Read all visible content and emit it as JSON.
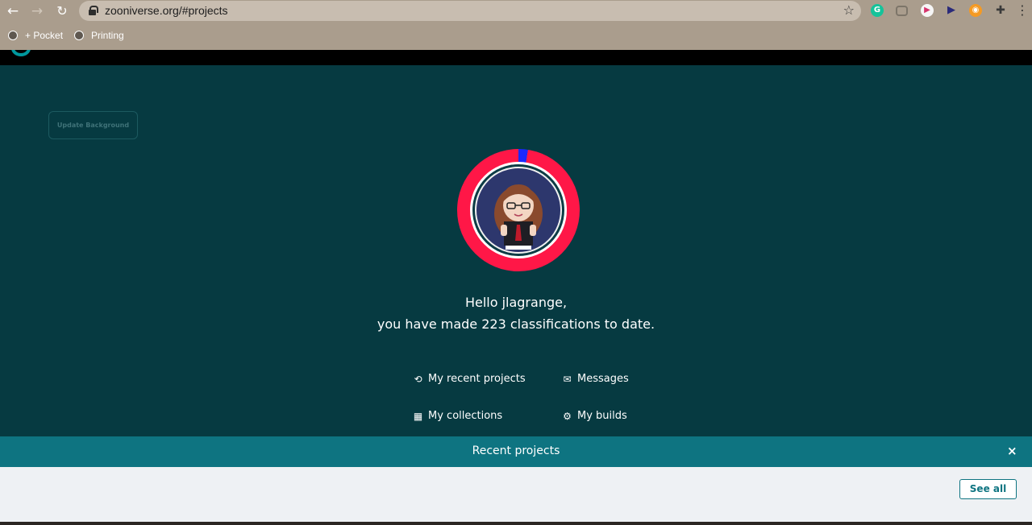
{
  "browser": {
    "url": "zooniverse.org/#projects",
    "bookmarks": [
      "+ Pocket",
      "Printing"
    ],
    "icons": [
      "back-arrow-icon",
      "forward-arrow-icon",
      "reload-icon",
      "lock-icon",
      "star-icon",
      "grammarly-icon",
      "pocket-icon",
      "extension-icon",
      "puzzle-icon",
      "menu-icon"
    ]
  },
  "site": {
    "update_background": "Update Background",
    "greeting_line1": "Hello jlagrange,",
    "greeting_line2": "you have made 223 classifications to date.",
    "links": {
      "recent_projects": "My recent projects",
      "messages": "Messages",
      "collections": "My collections",
      "builds": "My builds"
    },
    "recent": {
      "title": "Recent projects",
      "close": "×",
      "see_all": "See all"
    }
  },
  "colors": {
    "background": "#063a41",
    "ring_red": "#ff1747",
    "ring_blue": "#1a28ff",
    "accent_teal": "#0e7481"
  }
}
